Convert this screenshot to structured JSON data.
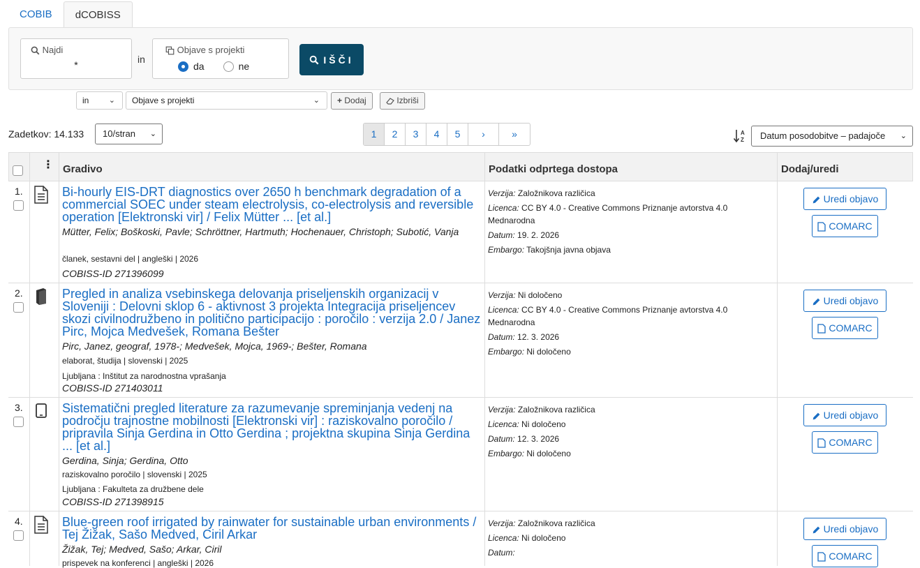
{
  "tabs": [
    {
      "label": "COBIB"
    },
    {
      "label": "dCOBISS"
    }
  ],
  "search": {
    "najdi_label": "Najdi",
    "najdi_value": "*",
    "in_label": "in",
    "objave_label": "Objave s projekti",
    "radio_da": "da",
    "radio_ne": "ne",
    "selected": "da",
    "search_button": "IŠČI"
  },
  "filter": {
    "operator": "in",
    "field": "Objave s projekti",
    "add_button": "Dodaj",
    "delete_button": "Izbriši"
  },
  "results": {
    "count_label": "Zadetkov: 14.133",
    "per_page": "10/stran",
    "pages": [
      "1",
      "2",
      "3",
      "4",
      "5"
    ],
    "current_page": "1",
    "next": "›",
    "last": "»",
    "sort": "Datum posodobitve – padajoče"
  },
  "table": {
    "columns": {
      "material": "Gradivo",
      "oa": "Podatki odprtega dostopa",
      "edit": "Dodaj/uredi"
    },
    "edit_button": "Uredi objavo",
    "comarc_button": "COMARC",
    "labels": {
      "verzija": "Verzija:",
      "licenca": "Licenca:",
      "datum": "Datum:",
      "embargo": "Embargo:"
    },
    "rows": [
      {
        "num": "1.",
        "type_icon": "article-icon",
        "title": "Bi-hourly EIS-DRT diagnostics over 2650 h benchmark degradation of a commercial SOEC under steam electrolysis, co-electrolysis and reversible operation [Elektronski vir] / Felix Mütter ... [et al.]",
        "authors": "Mütter, Felix; Boškoski, Pavle; Schröttner, Hartmuth; Hochenauer, Christoph; Subotić, Vanja",
        "meta": "članek, sestavni del | angleški | 2026",
        "publisher": "",
        "cobiss": "COBISS-ID 271396099",
        "verzija": "Založnikova različica",
        "licenca": "CC BY 4.0 - Creative Commons Priznanje avtorstva 4.0 Mednarodna",
        "datum": "19. 2. 2026",
        "embargo": "Takojšnja javna objava"
      },
      {
        "num": "2.",
        "type_icon": "book-icon",
        "title": "Pregled in analiza vsebinskega delovanja priseljenskih organizacij v Sloveniji : Delovni sklop 6 - aktivnost 3 projekta Integracija priseljencev skozi civilnodružbeno in politično participacijo : poročilo : verzija 2.0 / Janez Pirc, Mojca Medvešek, Romana Bešter",
        "authors": "Pirc, Janez, geograf, 1978-; Medvešek, Mojca, 1969-; Bešter, Romana",
        "meta": "elaborat, študija | slovenski | 2025",
        "publisher": "Ljubljana : Inštitut za narodnostna vprašanja",
        "cobiss": "COBISS-ID 271403011",
        "verzija": "Ni določeno",
        "licenca": "CC BY 4.0 - Creative Commons Priznanje avtorstva 4.0 Mednarodna",
        "datum": "12. 3. 2026",
        "embargo": "Ni določeno"
      },
      {
        "num": "3.",
        "type_icon": "tablet-icon",
        "title": "Sistematični pregled literature za razumevanje spreminjanja vedenj na področju trajnostne mobilnosti [Elektronski vir] : raziskovalno poročilo / pripravila Sinja Gerdina in Otto Gerdina ; projektna skupina Sinja Gerdina ... [et al.]",
        "authors": "Gerdina, Sinja; Gerdina, Otto",
        "meta": "raziskovalno poročilo | slovenski | 2025",
        "publisher": "Ljubljana : Fakulteta za družbene dele",
        "cobiss": "COBISS-ID 271398915",
        "verzija": "Založnikova različica",
        "licenca": "Ni določeno",
        "datum": "12. 3. 2026",
        "embargo": "Ni določeno"
      },
      {
        "num": "4.",
        "type_icon": "article-icon",
        "title": "Blue-green roof irrigated by rainwater for sustainable urban environments / Tej Žižak, Sašo Medved, Ciril Arkar",
        "authors": "Žižak, Tej; Medved, Sašo; Arkar, Ciril",
        "meta": "prispevek na konferenci | angleški | 2026",
        "publisher": "",
        "cobiss": "",
        "verzija": "Založnikova različica",
        "licenca": "Ni določeno",
        "datum": "",
        "embargo": ""
      }
    ]
  },
  "colors": {
    "accent": "#1a6ec4",
    "search_button": "#0b4a66",
    "header_bg": "#f2f2f2"
  }
}
